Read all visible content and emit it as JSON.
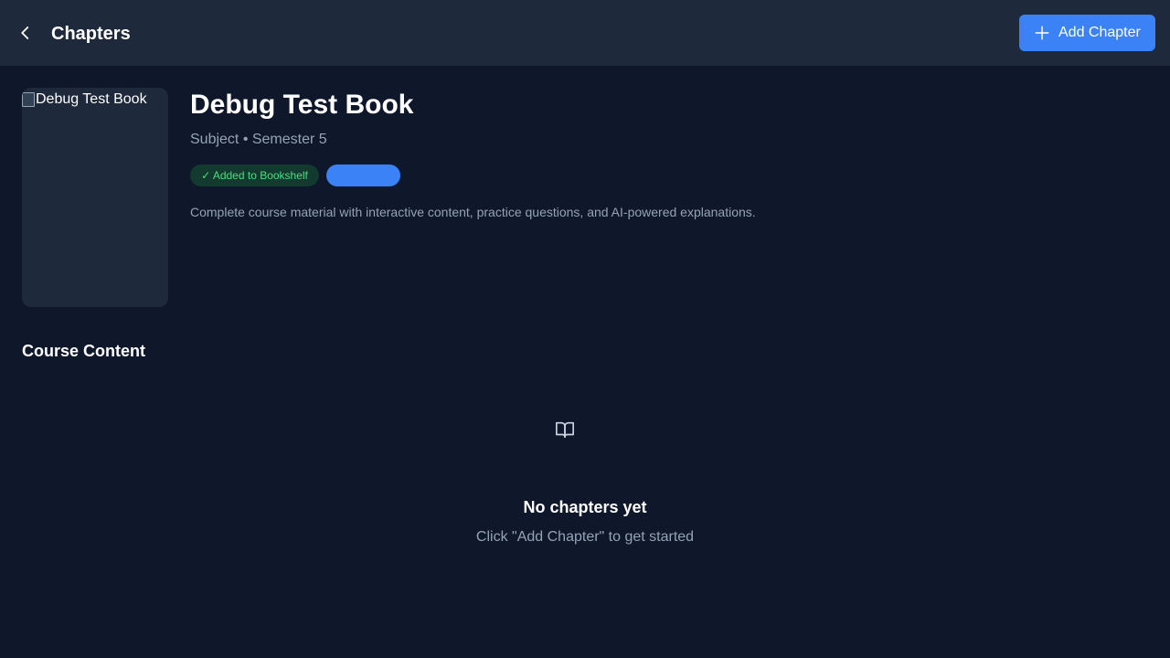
{
  "header": {
    "title": "Chapters",
    "back_icon": "chevron-left-icon",
    "add_button_label": "Add Chapter",
    "add_button_icon": "plus-icon"
  },
  "book": {
    "cover_alt": "Debug Test Book",
    "title": "Debug Test Book",
    "subtitle": "Subject • Semester 5",
    "bookshelf_badge": "✓ Added to Bookshelf",
    "blue_badge_label": "",
    "description": "Complete course material with interactive content, practice questions, and AI-powered explanations."
  },
  "content": {
    "section_title": "Course Content",
    "empty_icon": "book-open-icon",
    "empty_title": "No chapters yet",
    "empty_subtitle": "Click \"Add Chapter\" to get started"
  },
  "colors": {
    "background": "#0f172a",
    "topbar": "#1e293b",
    "accent": "#3b82f6",
    "success_text": "#4ade80",
    "muted_text": "#94a3b8"
  }
}
